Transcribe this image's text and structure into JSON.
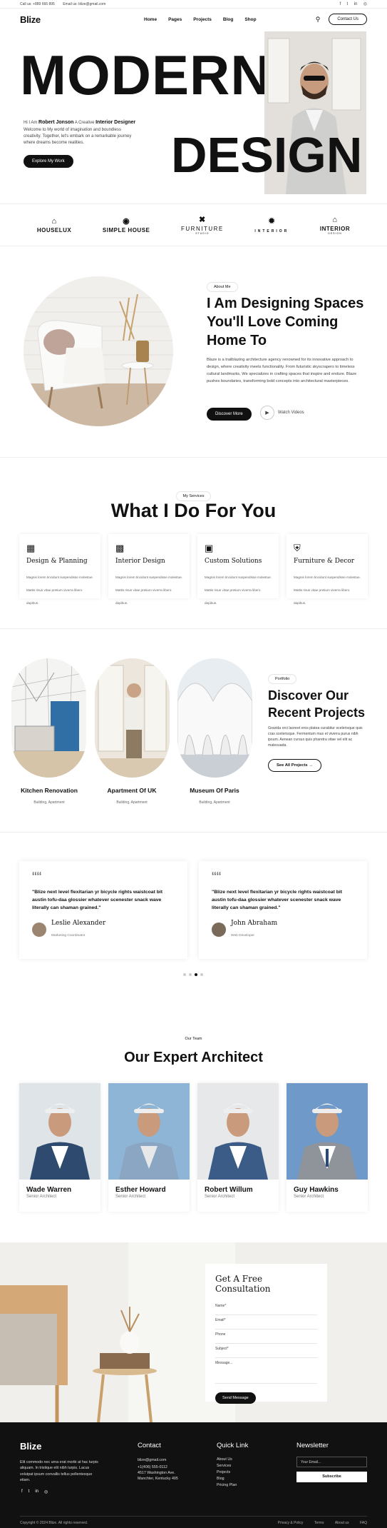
{
  "topbar": {
    "call": "Call us: +889 666 895",
    "email": "Email us: blize@gmail.com",
    "socials": [
      "f",
      "t",
      "in",
      "◎"
    ]
  },
  "nav": {
    "logo": "Blize",
    "links": [
      "Home",
      "Pages",
      "Projects",
      "Blog",
      "Shop"
    ],
    "contact_label": "Contact Us"
  },
  "hero": {
    "title_line1": "MODERN",
    "title_line2": "DESIGN",
    "intro_prefix": "Hi I Am",
    "name": "Robert Jonson",
    "intro_mid": "A Creative",
    "role": "Interior Designer",
    "body": "Welcome to My world of imagination and boundless creativity. Together, let's embark on a remarkable journey where dreams become realities.",
    "cta": "Explore My Work"
  },
  "brands": [
    {
      "icon": "house-logo-icon",
      "name": "HOUSELUX",
      "sub": ""
    },
    {
      "icon": "chair-logo-icon",
      "name": "SIMPLE HOUSE",
      "sub": ""
    },
    {
      "icon": "furniture-logo-icon",
      "name": "FURNITURE",
      "sub": "STUDIO"
    },
    {
      "icon": "interior-circle-logo-icon",
      "name": "INTERIOR",
      "sub": ""
    },
    {
      "icon": "interior-house-logo-icon",
      "name": "INTERIOR",
      "sub": "DESIGN"
    }
  ],
  "about": {
    "eyebrow": "About Me",
    "title": "I Am Designing Spaces You'll Love Coming Home To",
    "body": "Blaze is a trailblazing architecture agency renowned for its innovative approach to design, where creativity meets functionality. From futuristic skyscrapers to timeless cultural landmarks, We specializes in crafting spaces that inspire and endure. Blaze pushes boundaries, transforming bold concepts into architectural masterpieces.",
    "cta": "Discover More",
    "video_label": "Watch Videos"
  },
  "services": {
    "eyebrow": "My Services",
    "title": "What I Do For You",
    "cards": [
      {
        "icon": "design-planning-icon",
        "title": "Design & Planning",
        "desc": "Magnis lorem tincidunt suspendisse molestue. Mattis risus vitae pretium viverra libero dapibus."
      },
      {
        "icon": "interior-design-icon",
        "title": "Interior Design",
        "desc": "Magnis lorem tincidunt suspendisse molestue. Mattis risus vitae pretium viverra libero dapibus."
      },
      {
        "icon": "custom-solutions-icon",
        "title": "Custom Solutions",
        "desc": "Magnis lorem tincidunt suspendisse molestue. Mattis risus vitae pretium viverra libero dapibus."
      },
      {
        "icon": "furniture-decor-icon",
        "title": "Furniture & Decor",
        "desc": "Magnis lorem tincidunt suspendisse molestue. Mattis risus vitae pretium viverra libero dapibus."
      }
    ]
  },
  "portfolio": {
    "eyebrow": "Portfolio",
    "title": "Discover Our Recent Projects",
    "body": "Gravida orci laoreet eros platea curabitur scelerisque quis cras scelerisque. Fermentum mus et viverra purus nibh ipsum. Aenean cursus quis pharetra vitae vel elit ac malesuada.",
    "cta": "See All Projects →",
    "items": [
      {
        "title": "Kitchen Renovation",
        "sub": "Building, Apartment"
      },
      {
        "title": "Apartment Of UK",
        "sub": "Building, Apartment"
      },
      {
        "title": "Museum Of Paris",
        "sub": "Building, Apartment"
      }
    ]
  },
  "testimonials": {
    "items": [
      {
        "quote": "\"Blize next level flexitarian yr bicycle rights waistcoat bit austin tofu-daa glossier whatever scenester snack wave literally can shaman grained.\"",
        "name": "Leslie Alexander",
        "role": "Marketing Coordinator"
      },
      {
        "quote": "\"Blize next level flexitarian yr bicycle rights waistcoat bit austin tofu-daa glossier whatever scenester snack wave literally can shaman grained.\"",
        "name": "John Abraham",
        "role": "Web Developer"
      }
    ],
    "active_dot": 2,
    "dot_count": 4
  },
  "team": {
    "eyebrow": "Our Team",
    "title": "Our Expert Architect",
    "members": [
      {
        "name": "Wade Warren",
        "role": "Senior Architect"
      },
      {
        "name": "Esther Howard",
        "role": "Senior Architect"
      },
      {
        "name": "Robert Willum",
        "role": "Senior Architect"
      },
      {
        "name": "Guy Hawkins",
        "role": "Senior Architect"
      }
    ]
  },
  "consult": {
    "title": "Get A Free Consultation",
    "fields": [
      "Name*",
      "Email*",
      "Phone",
      "Subject*",
      "Message..."
    ],
    "submit": "Send Message"
  },
  "footer": {
    "logo": "Blize",
    "about": "Elit commodo nec urna erat morbi at hac turpis aliquam. In tristique elit nibh turpis. Lacus volutpat ipsum convallis tellus pellentesque etiam.",
    "socials": [
      "f",
      "t",
      "in",
      "◎"
    ],
    "contact": {
      "heading": "Contact",
      "items": [
        "blize@gmail.com",
        "+1(406) 555-0112",
        "4517 Washington Ave. Manchter, Kentucky 495"
      ]
    },
    "quick": {
      "heading": "Quick Link",
      "items": [
        "About Us",
        "Services",
        "Projects",
        "Blog",
        "Pricing Plan"
      ]
    },
    "newsletter": {
      "heading": "Newsletter",
      "placeholder": "Your Email...",
      "button": "Subscribe"
    },
    "copyright": "Copyright © 2024 Blize. All rights reserved.",
    "bottom_links": [
      "Privacy & Policy",
      "Terms",
      "About us",
      "FAQ"
    ]
  },
  "colors": {
    "accent": "#111111",
    "background": "#ffffff",
    "muted": "#f3f2f0"
  }
}
